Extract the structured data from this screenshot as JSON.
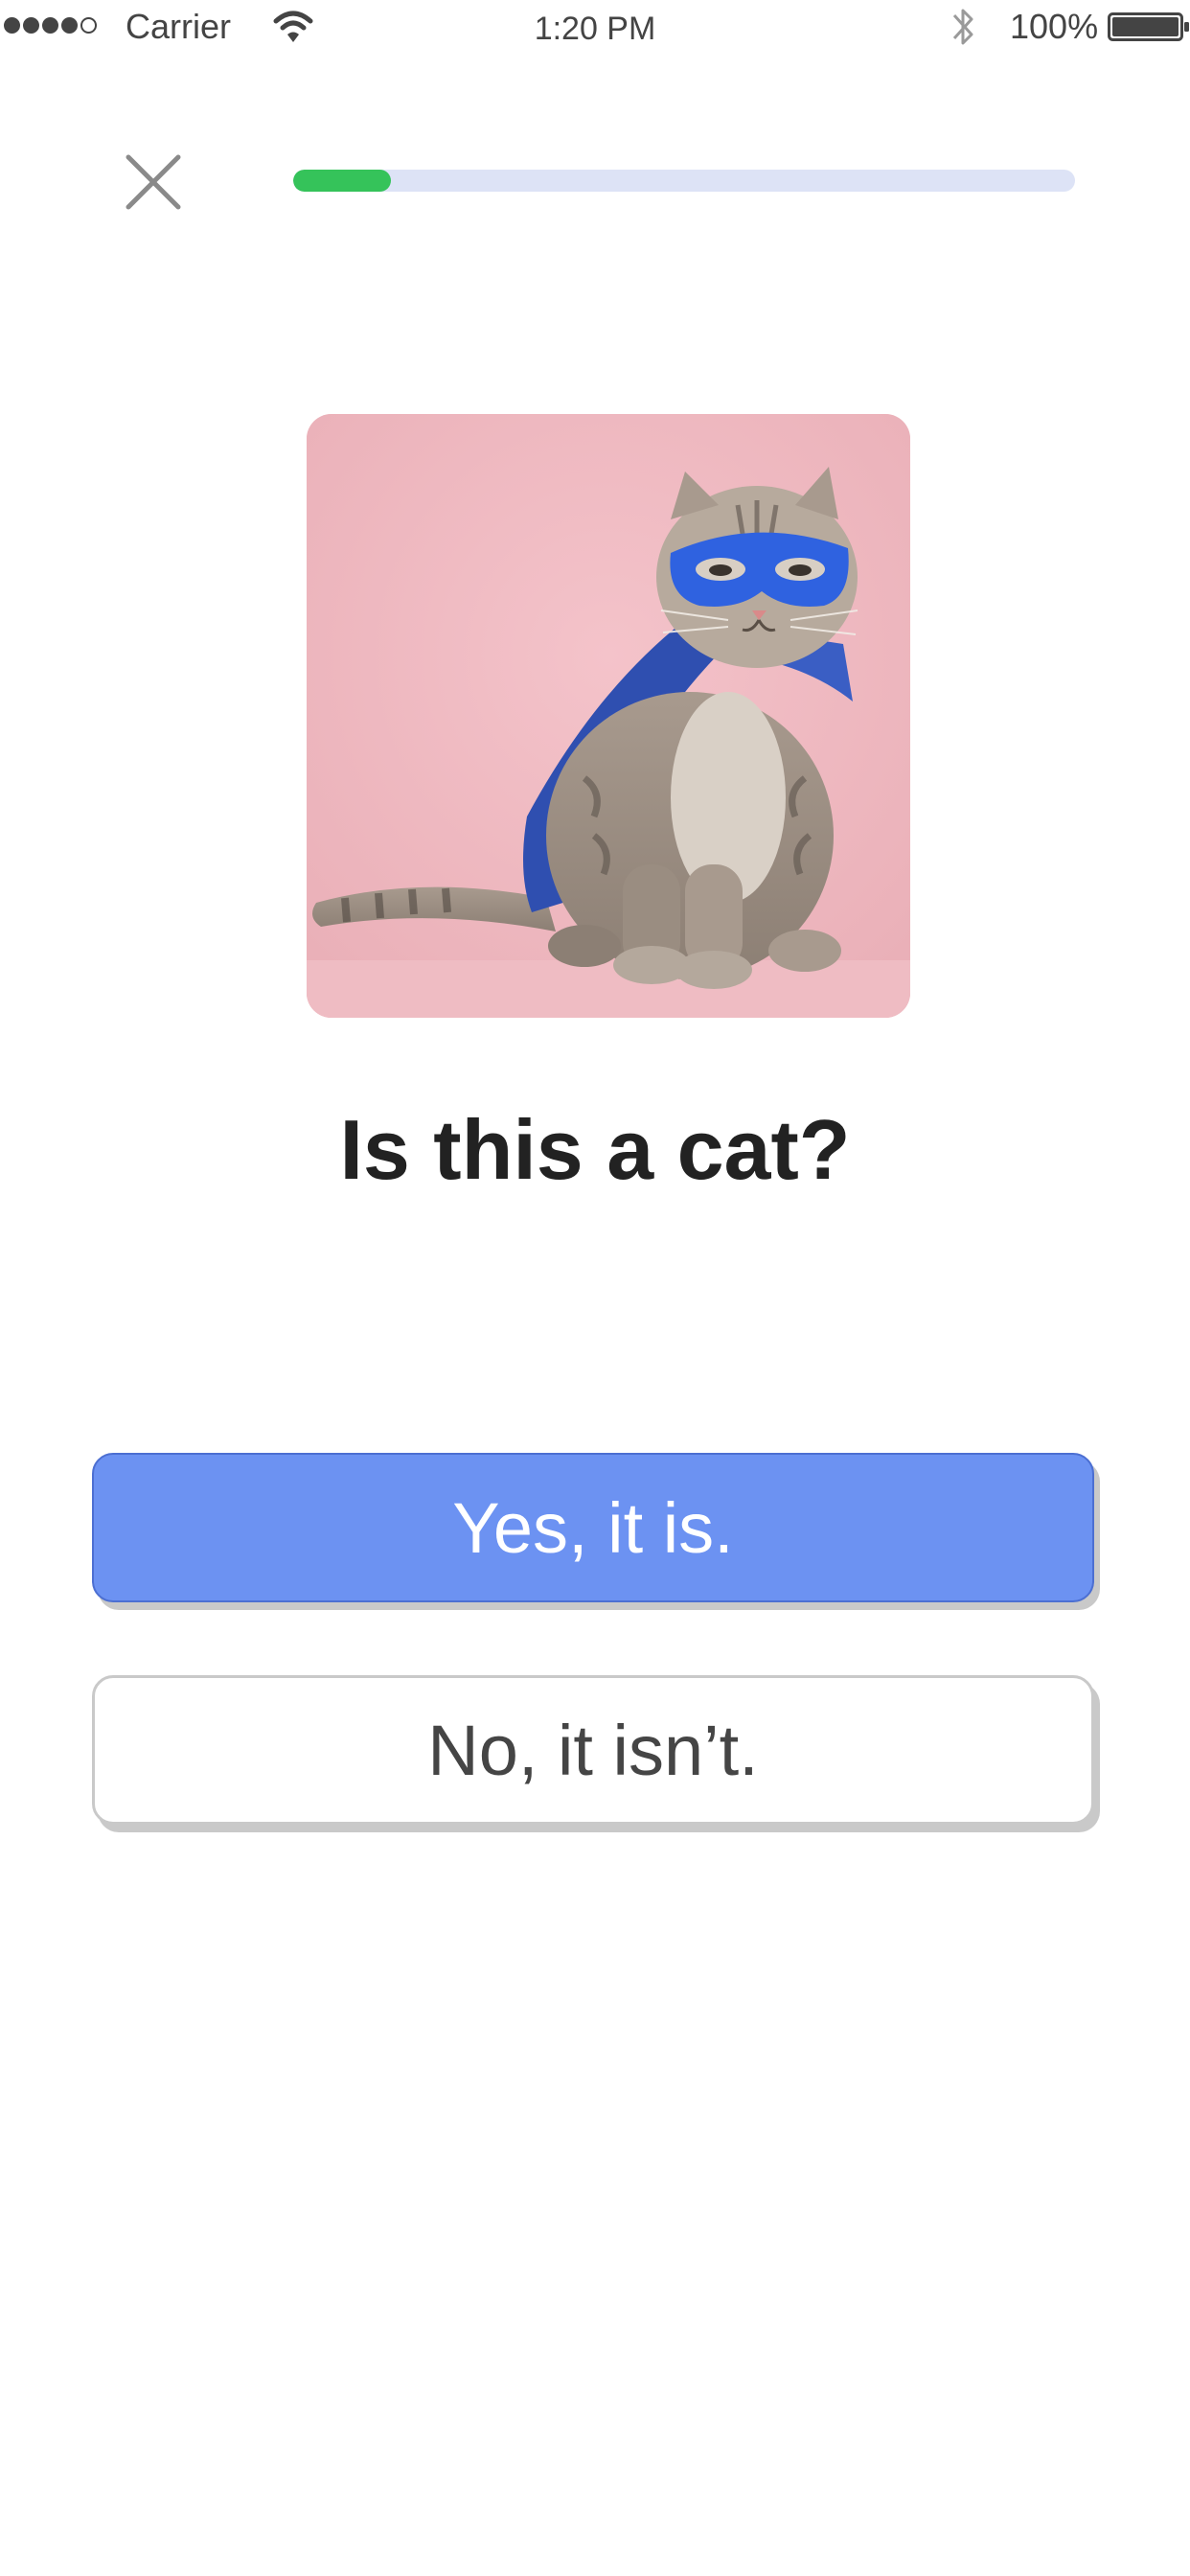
{
  "status_bar": {
    "carrier": "Carrier",
    "time": "1:20 PM",
    "battery": "100%",
    "signal_bars_filled": 4,
    "signal_bars_total": 5
  },
  "quiz": {
    "progress_fraction": 0.125,
    "question": "Is this a cat?",
    "answers": {
      "yes": "Yes, it is.",
      "no": "No, it isn’t."
    }
  },
  "icons": {
    "close": "close-icon",
    "wifi": "wifi-icon",
    "bluetooth": "bluetooth-icon",
    "battery": "battery-icon"
  },
  "colors": {
    "progress_fill": "#35c35a",
    "progress_track": "#dde3f6",
    "primary_button": "#6c92f2",
    "image_background": "#f0b9c1"
  }
}
